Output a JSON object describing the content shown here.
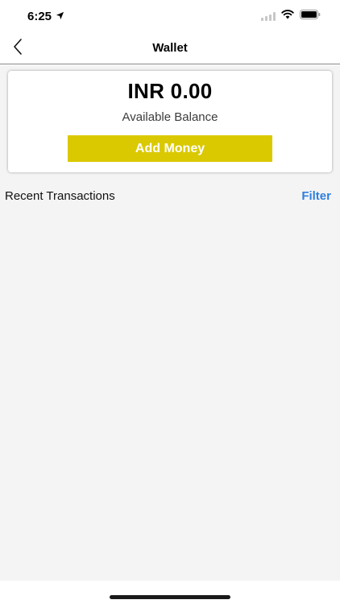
{
  "status_bar": {
    "time": "6:25"
  },
  "nav": {
    "title": "Wallet"
  },
  "wallet": {
    "balance": "INR 0.00",
    "balance_label": "Available Balance",
    "add_money_label": "Add Money"
  },
  "transactions": {
    "title": "Recent Transactions",
    "filter_label": "Filter"
  },
  "colors": {
    "accent_button": "#dac900",
    "link": "#2f7fde",
    "content_bg": "#f4f4f4"
  },
  "icons": {
    "back": "chevron-left-icon",
    "location": "location-arrow-icon",
    "signal": "cellular-signal-icon",
    "wifi": "wifi-icon",
    "battery": "battery-icon"
  }
}
